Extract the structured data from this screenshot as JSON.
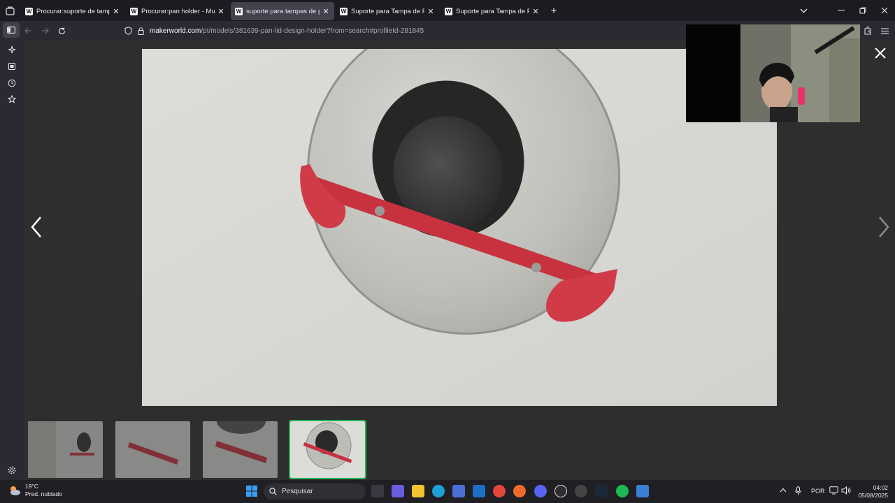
{
  "browser": {
    "tabs": [
      {
        "label": "Procurar:suporte de tampa de p",
        "active": false
      },
      {
        "label": "Procurar:pan holder - Mundo d",
        "active": false
      },
      {
        "label": "suporte para tampas de panela",
        "active": true
      },
      {
        "label": "Suporte para Tampa de Panela |",
        "active": false
      },
      {
        "label": "Suporte para Tampa de Panela |",
        "active": false
      }
    ],
    "tab_favicon_letter": "W",
    "new_tab_symbol": "+",
    "url_host": "makerworld.com",
    "url_path": "/pt/models/381639-pan-lid-design-holder?from=search#profileId-281845"
  },
  "viewer": {
    "thumbnails_count": 4,
    "active_thumbnail": 4
  },
  "taskbar": {
    "weather_temp": "19°C",
    "weather_desc": "Pred. nublado",
    "search_placeholder": "Pesquisar",
    "language": "POR",
    "time": "04:02",
    "date": "05/08/2025"
  },
  "colors": {
    "accent_green": "#22b455",
    "holder_red": "#c8323f",
    "tab_active": "#42414d"
  },
  "icons": [
    "tab-list-icon",
    "back-icon",
    "forward-icon",
    "reload-icon",
    "shield-icon",
    "lock-icon",
    "extensions-icon",
    "menu-icon",
    "sidebar-icon",
    "ai-icon",
    "bookmarks-icon",
    "history-icon",
    "star-icon",
    "settings-icon",
    "close-icon",
    "prev-arrow-icon",
    "next-arrow-icon",
    "windows-start-icon",
    "search-icon",
    "mic-icon",
    "speaker-icon"
  ]
}
